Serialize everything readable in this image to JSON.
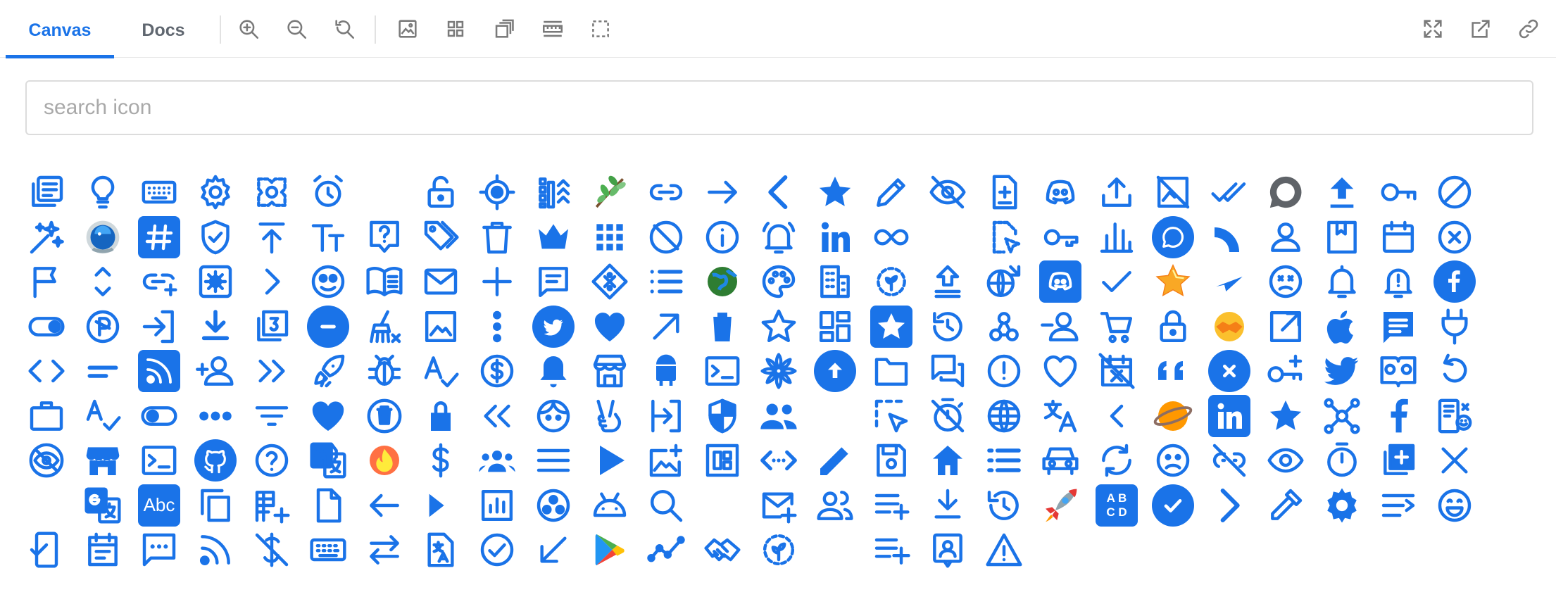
{
  "tabs": [
    {
      "label": "Canvas",
      "active": true
    },
    {
      "label": "Docs",
      "active": false
    }
  ],
  "toolbar_left": [
    "zoom-in-icon",
    "zoom-out-icon",
    "reset-zoom-icon",
    "image-icon",
    "grid-icon",
    "copy-stack-icon",
    "ruler-icon",
    "select-box-icon"
  ],
  "toolbar_right": [
    "fullscreen-icon",
    "open-external-icon",
    "link-icon"
  ],
  "search": {
    "placeholder": "search icon",
    "value": ""
  },
  "accent": "#1a73e8",
  "icons": [
    "list-alt",
    "lightbulb",
    "keyboard",
    "settings",
    "puzzle-pattern",
    "alarm",
    "blank",
    "lock-open",
    "gps-fixed",
    "ruler-sort",
    "sprout",
    "link",
    "arrow-right",
    "chevron-left",
    "star",
    "pencil",
    "eye-off",
    "file-add",
    "discord",
    "upload",
    "image-off",
    "done-all",
    "comment-grey",
    "upload-bar",
    "key",
    "block",
    "sparkles",
    "astronaut",
    "hashtag",
    "shield-check",
    "arrow-up-bar",
    "text-size",
    "help-box",
    "tags",
    "trash",
    "crown",
    "apps",
    "do-not-disturb",
    "info",
    "bell-ring",
    "linkedin",
    "infinity",
    "blank",
    "file-cursor",
    "key-outline",
    "bar-chart",
    "chat-circle",
    "quarter-circle",
    "person",
    "bookmark-book",
    "calendar",
    "cancel",
    "flag",
    "unfold",
    "link-add",
    "settings-box",
    "chevron-right",
    "face-smiley",
    "book-open",
    "mail",
    "plus",
    "message-square",
    "diamond-dots",
    "list",
    "earth",
    "palette",
    "building",
    "gear-sprout",
    "upload-file",
    "globe-lock",
    "discord-box",
    "check",
    "star-gold",
    "send",
    "face-sad",
    "bell",
    "bell-alert",
    "facebook-round",
    "toggle",
    "poly-circle",
    "login",
    "download",
    "filter-3",
    "minus-circle",
    "broom",
    "image",
    "more-vert",
    "twitter-round",
    "heart",
    "arrow-up-right",
    "delete",
    "star-outline",
    "dashboard",
    "star-filled",
    "restore",
    "webhook",
    "person-remove",
    "cart",
    "lock",
    "handshake",
    "open-in-new",
    "apple",
    "comment",
    "plug",
    "code",
    "short-text",
    "rss",
    "person-add",
    "double-right",
    "rocket",
    "bug",
    "spellcheck",
    "dollar-circle",
    "bell-solid",
    "store",
    "android",
    "terminal",
    "flower",
    "arrow-up-circle",
    "folder",
    "forum",
    "error",
    "favorite-border",
    "event-busy",
    "quote",
    "cancel-circle",
    "key-add",
    "twitter",
    "book-reader",
    "replay",
    "briefcase",
    "spell-ab",
    "toggle-off",
    "more-horiz",
    "filter-list",
    "heart-solid",
    "delete-circle",
    "lock-solid",
    "double-left",
    "face",
    "victory",
    "exit-to-app",
    "security",
    "group",
    "blank",
    "select-cursor",
    "timer-off",
    "globe",
    "translate",
    "chevron-small",
    "planet",
    "linkedin-box",
    "star-solid",
    "hub",
    "facebook",
    "devices",
    "visibility-off-circle",
    "storefront",
    "terminal-box",
    "github",
    "help-circle",
    "google-translate",
    "fire",
    "dollar",
    "groups",
    "menu",
    "play",
    "add-photo",
    "view-quilt",
    "code-dots",
    "edit",
    "save",
    "home",
    "list-bullets",
    "car",
    "sync",
    "sentiment-sad",
    "link-off",
    "visibility",
    "timer",
    "add-box",
    "close",
    "blank",
    "translate-g",
    "abc",
    "content-copy",
    "domain-add",
    "file",
    "arrow-back",
    "skip-next",
    "analytics",
    "soccer",
    "android-head",
    "search",
    "blank",
    "mail-add",
    "people",
    "playlist-add",
    "file-download",
    "history",
    "rocket-color",
    "abcd",
    "check-circle",
    "chevron-right-large",
    "eyedropper",
    "gear-solid",
    "wrap-text",
    "emoji-grin",
    "mobile-check",
    "event-note",
    "sms",
    "rss-feed",
    "money-off",
    "keyboard-outline",
    "swap",
    "translate-file",
    "check-circle-outline",
    "south-west",
    "google-play",
    "timeline",
    "handshake-outline",
    "gear-sprout-dashed",
    "blank",
    "playlist-add-2",
    "portrait",
    "warning"
  ]
}
